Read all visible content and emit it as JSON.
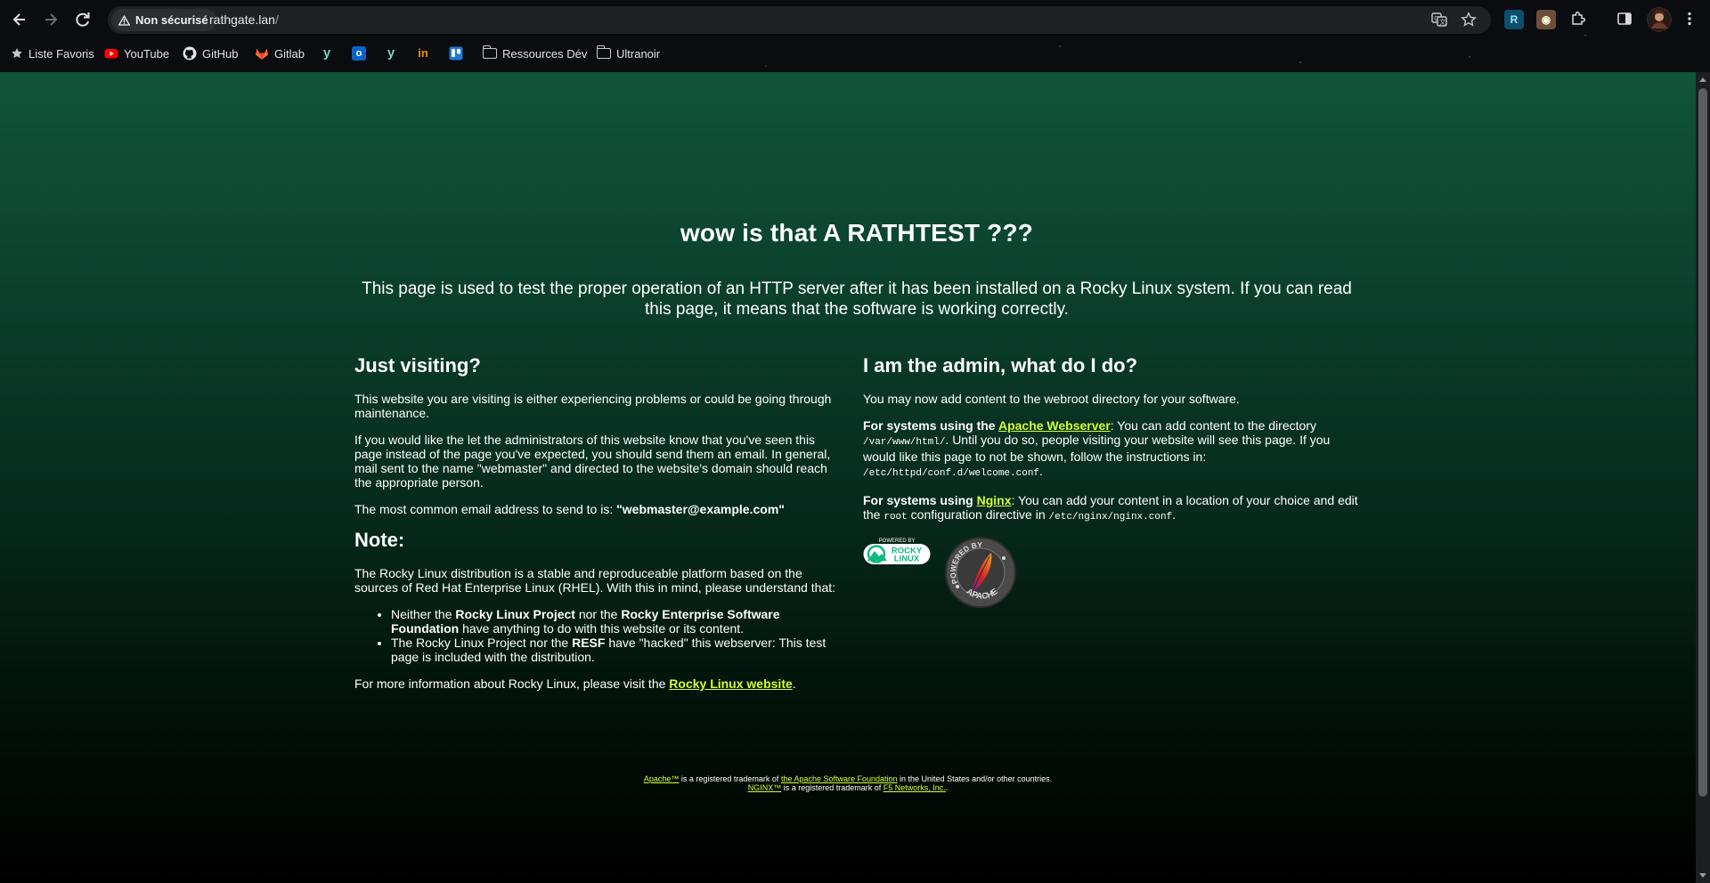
{
  "browser": {
    "security_label": "Non sécurisé",
    "url_host": "rathgate.lan",
    "url_path": "/",
    "bookmarks": [
      {
        "label": "Liste Favoris",
        "icon": "star-icon"
      },
      {
        "label": "YouTube",
        "icon": "youtube-icon"
      },
      {
        "label": "GitHub",
        "icon": "github-icon"
      },
      {
        "label": "Gitlab",
        "icon": "gitlab-icon"
      },
      {
        "label": "",
        "icon": "yammer-icon"
      },
      {
        "label": "",
        "icon": "outlook-icon"
      },
      {
        "label": "",
        "icon": "yammer-icon"
      },
      {
        "label": "",
        "icon": "indeed-icon"
      },
      {
        "label": "",
        "icon": "trello-icon"
      },
      {
        "label": "Ressources Dév",
        "icon": "folder-icon"
      },
      {
        "label": "Ultranoir",
        "icon": "folder-icon"
      }
    ]
  },
  "page": {
    "title_prefix": "wow is that ",
    "title_strong": "A RATHTEST ???",
    "intro": "This page is used to test the proper operation of an HTTP server after it has been installed on a Rocky Linux system. If you can read this page, it means that the software is working correctly.",
    "left": {
      "heading": "Just visiting?",
      "p1": "This website you are visiting is either experiencing problems or could be going through maintenance.",
      "p2": "If you would like the let the administrators of this website know that you've seen this page instead of the page you've expected, you should send them an email. In general, mail sent to the name \"webmaster\" and directed to the website's domain should reach the appropriate person.",
      "p3_prefix": "The most common email address to send to is: ",
      "p3_email": "\"webmaster@example.com\"",
      "note_heading": "Note:",
      "note_p": "The Rocky Linux distribution is a stable and reproduceable platform based on the sources of Red Hat Enterprise Linux (RHEL). With this in mind, please understand that:",
      "li1_a": "Neither the ",
      "li1_b": "Rocky Linux Project",
      "li1_c": " nor the ",
      "li1_d": "Rocky Enterprise Software Foundation",
      "li1_e": " have anything to do with this website or its content.",
      "li2_a": "The Rocky Linux Project nor the ",
      "li2_b": "RESF",
      "li2_c": " have \"hacked\" this webserver: This test page is included with the distribution.",
      "more_prefix": "For more information about Rocky Linux, please visit the ",
      "more_link": "Rocky Linux website",
      "more_suffix": "."
    },
    "right": {
      "heading": "I am the admin, what do I do?",
      "p1": "You may now add content to the webroot directory for your software.",
      "apache_prefix": "For systems using the ",
      "apache_link": "Apache Webserver",
      "apache_a": ": You can add content to the directory ",
      "apache_dir": "/var/www/html/",
      "apache_b": ". Until you do so, people visiting your website will see this page. If you would like this page to not be shown, follow the instructions in: ",
      "apache_conf": "/etc/httpd/conf.d/welcome.conf",
      "apache_end": ".",
      "nginx_prefix": "For systems using ",
      "nginx_link": "Nginx",
      "nginx_a": ": You can add your content in a location of your choice and edit the ",
      "nginx_root": "root",
      "nginx_b": " configuration directive in ",
      "nginx_conf": "/etc/nginx/nginx.conf",
      "nginx_end": ".",
      "rocky_badge_top": "POWERED BY",
      "rocky_badge_l1": "ROCKY",
      "rocky_badge_l2": "LINUX",
      "apache_badge_top": "POWERED BY",
      "apache_badge_bottom": "APACHE"
    },
    "footer": {
      "l1_link1": "Apache™",
      "l1_text1": " is a registered trademark of ",
      "l1_link2": "the Apache Software Foundation",
      "l1_text2": " in the United States and/or other countries.",
      "l2_link1": "NGINX™",
      "l2_text1": " is a registered trademark of ",
      "l2_link2": "F5 Networks, Inc.",
      "l2_text2": "."
    }
  },
  "colors": {
    "link": "#d4ff33",
    "bg_top": "#10543a",
    "bg_bottom": "#000000"
  }
}
